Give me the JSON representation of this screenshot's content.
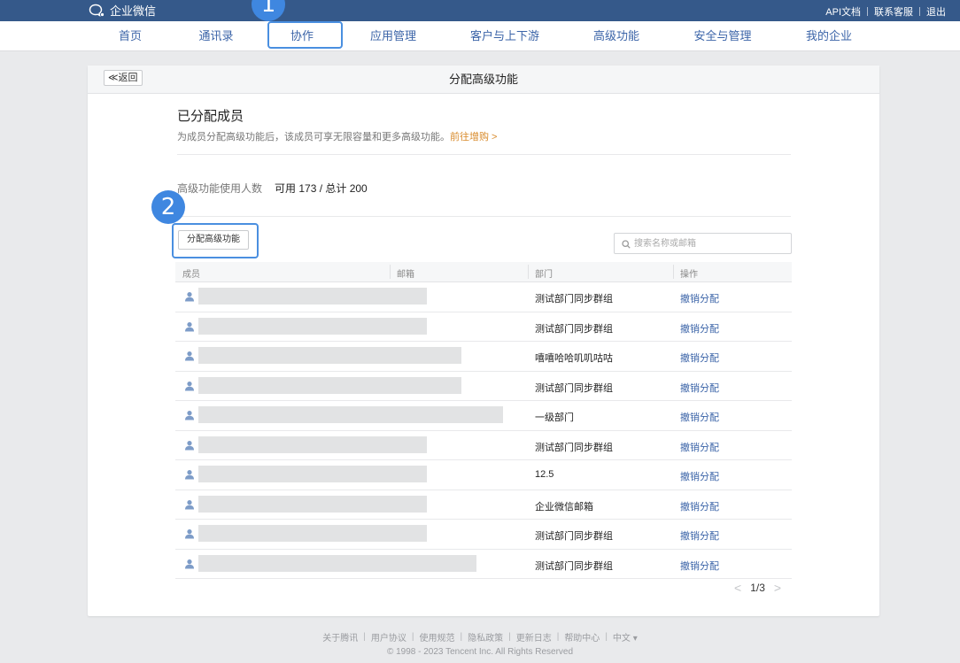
{
  "app": {
    "logo_text": "企业微信",
    "top_links": [
      "API文档",
      "联系客服",
      "退出"
    ]
  },
  "nav": {
    "items": [
      "首页",
      "通讯录",
      "协作",
      "应用管理",
      "客户与上下游",
      "高级功能",
      "安全与管理",
      "我的企业"
    ],
    "active": "协作"
  },
  "badges": [
    "1",
    "2"
  ],
  "page": {
    "back_label": "≪返回",
    "title": "分配高级功能",
    "section_title": "已分配成员",
    "section_desc": "为成员分配高级功能后，该成员可享无限容量和更多高级功能。",
    "section_link": "前往增购 >",
    "usage_label": "高级功能使用人数",
    "usage_value": "可用 173 / 总计 200",
    "assign_button": "分配高级功能",
    "search_placeholder": "搜索名称或邮箱"
  },
  "table": {
    "headers": [
      "成员",
      "邮箱",
      "部门",
      "操作"
    ],
    "rows": [
      {
        "dept": "测试部门同步群组",
        "action": "撤销分配"
      },
      {
        "dept": "测试部门同步群组",
        "action": "撤销分配"
      },
      {
        "dept": "嘻嘻哈哈叽叽咕咕",
        "action": "撤销分配"
      },
      {
        "dept": "测试部门同步群组",
        "action": "撤销分配"
      },
      {
        "dept": "一级部门",
        "action": "撤销分配"
      },
      {
        "dept": "测试部门同步群组",
        "action": "撤销分配"
      },
      {
        "dept": "12.5",
        "action": "撤销分配"
      },
      {
        "dept": "企业微信邮箱",
        "action": "撤销分配"
      },
      {
        "dept": "测试部门同步群组",
        "action": "撤销分配"
      },
      {
        "dept": "测试部门同步群组",
        "action": "撤销分配"
      }
    ]
  },
  "pager": {
    "prev": "<",
    "label": "1/3",
    "next": ">"
  },
  "footer": {
    "links": [
      "关于腾讯",
      "用户协议",
      "使用规范",
      "隐私政策",
      "更新日志",
      "帮助中心",
      "中文 ▾"
    ],
    "copyright": "© 1998 - 2023 Tencent Inc. All Rights Reserved"
  },
  "colors": {
    "topbar": "#35598a",
    "nav_link": "#3b64a8",
    "accent_link": "#d88a2a",
    "callout": "#4a8fe0",
    "badge": "#3f87e0"
  }
}
